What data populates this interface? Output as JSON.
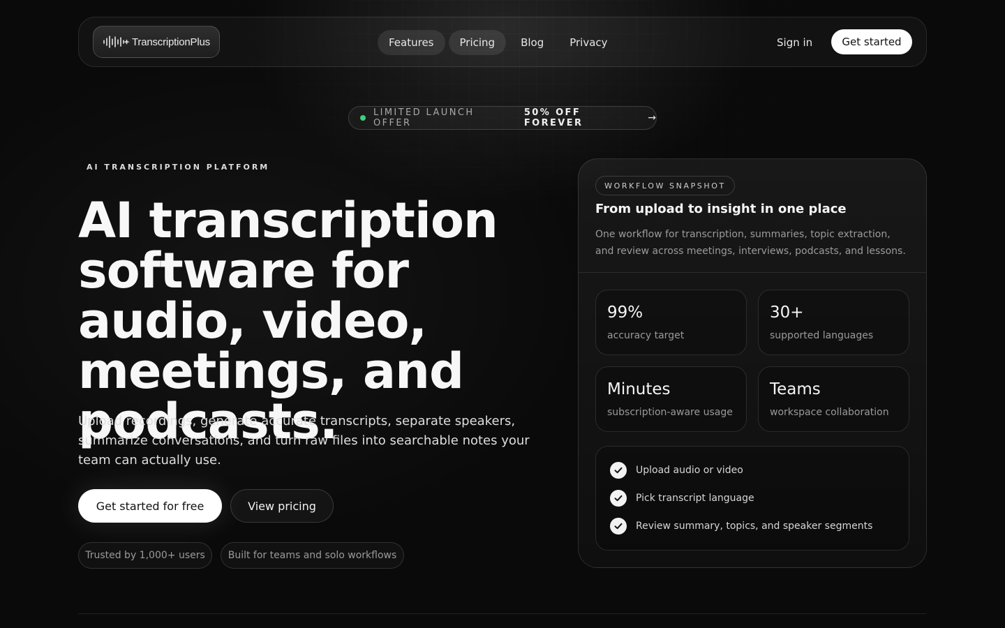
{
  "nav": {
    "logo_text": "TranscriptionPlus",
    "links": [
      "Features",
      "Pricing",
      "Blog",
      "Privacy"
    ],
    "signin": "Sign in",
    "cta": "Get started"
  },
  "offer": {
    "label": "LIMITED LAUNCH OFFER",
    "highlight": "50% OFF FOREVER",
    "arrow": "→",
    "dot_color": "#3ecf7b"
  },
  "hero": {
    "eyebrow": "AI TRANSCRIPTION PLATFORM",
    "headline": "AI transcription software for audio, video, meetings, and podcasts.",
    "subtext": "Upload recordings, generate accurate transcripts, separate speakers, summarize conversations, and turn raw files into searchable notes your team can actually use.",
    "cta_primary": "Get started for free",
    "cta_secondary": "View pricing",
    "trust": [
      "Trusted by 1,000+ users",
      "Built for teams and solo workflows"
    ]
  },
  "card": {
    "badge": "WORKFLOW SNAPSHOT",
    "title": "From upload to insight in one place",
    "description": "One workflow for transcription, summaries, topic extraction, and review across meetings, interviews, podcasts, and lessons.",
    "stats": [
      {
        "value": "99%",
        "label": "accuracy target"
      },
      {
        "value": "30+",
        "label": "supported languages"
      },
      {
        "value": "Minutes",
        "label": "subscription-aware usage"
      },
      {
        "value": "Teams",
        "label": "workspace collaboration"
      }
    ],
    "steps": [
      "Upload audio or video",
      "Pick transcript language",
      "Review summary, topics, and speaker segments"
    ]
  },
  "icons": {
    "logo": "waveform-icon",
    "step": "check-icon"
  },
  "colors": {
    "background": "#0a0a0a",
    "accent_green": "#3ecf7b",
    "button_primary": "#ffffff"
  }
}
